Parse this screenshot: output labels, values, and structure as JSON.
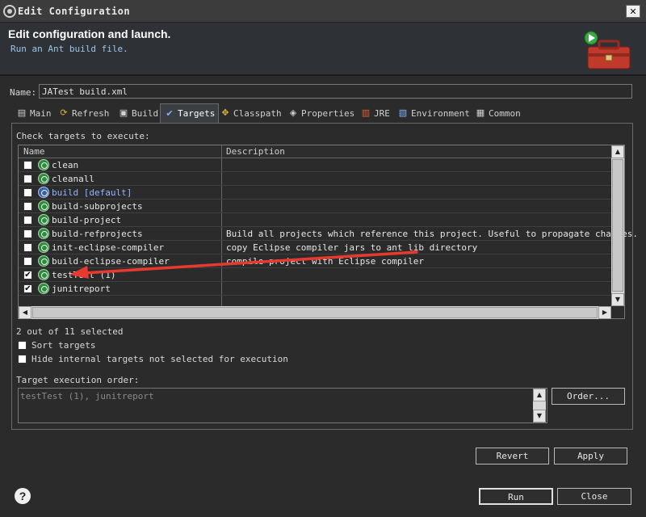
{
  "window": {
    "title": "Edit Configuration",
    "close_glyph": "✕"
  },
  "header": {
    "title": "Edit configuration and launch.",
    "subtitle": "Run an Ant build file."
  },
  "name": {
    "label": "Name:",
    "value": "JATest build.xml"
  },
  "tabs": [
    {
      "label": "Main",
      "icon": "main-icon"
    },
    {
      "label": "Refresh",
      "icon": "refresh-icon"
    },
    {
      "label": "Build",
      "icon": "build-icon"
    },
    {
      "label": "Targets",
      "icon": "targets-icon",
      "active": true
    },
    {
      "label": "Classpath",
      "icon": "classpath-icon"
    },
    {
      "label": "Properties",
      "icon": "properties-icon"
    },
    {
      "label": "JRE",
      "icon": "jre-icon"
    },
    {
      "label": "Environment",
      "icon": "environment-icon"
    },
    {
      "label": "Common",
      "icon": "common-icon"
    }
  ],
  "targets": {
    "heading": "Check targets to execute:",
    "columns": [
      "Name",
      "Description"
    ],
    "rows": [
      {
        "name": "clean",
        "description": "",
        "checked": false
      },
      {
        "name": "cleanall",
        "description": "",
        "checked": false
      },
      {
        "name": "build [default]",
        "description": "",
        "checked": false,
        "default": true
      },
      {
        "name": "build-subprojects",
        "description": "",
        "checked": false
      },
      {
        "name": "build-project",
        "description": "",
        "checked": false
      },
      {
        "name": "build-refprojects",
        "description": "Build all projects which reference this project. Useful to propagate changes.",
        "checked": false
      },
      {
        "name": "init-eclipse-compiler",
        "description": "copy Eclipse compiler jars to ant lib directory",
        "checked": false
      },
      {
        "name": "build-eclipse-compiler",
        "description": "compile project with Eclipse compiler",
        "checked": false
      },
      {
        "name": "testTest (1)",
        "description": "",
        "checked": true
      },
      {
        "name": "junitreport",
        "description": "",
        "checked": true
      }
    ],
    "selected_count": "2 out of 11 selected",
    "sort_label": "Sort targets",
    "hide_label": "Hide internal targets not selected for execution",
    "order_label": "Target execution order:",
    "order_value": "testTest (1), junitreport"
  },
  "buttons": {
    "order": "Order...",
    "revert": "Revert",
    "apply": "Apply",
    "run": "Run",
    "close": "Close",
    "help": "?"
  },
  "colors": {
    "annotation_arrow": "#e8392f",
    "dialog_bg": "#2b2b2b"
  }
}
